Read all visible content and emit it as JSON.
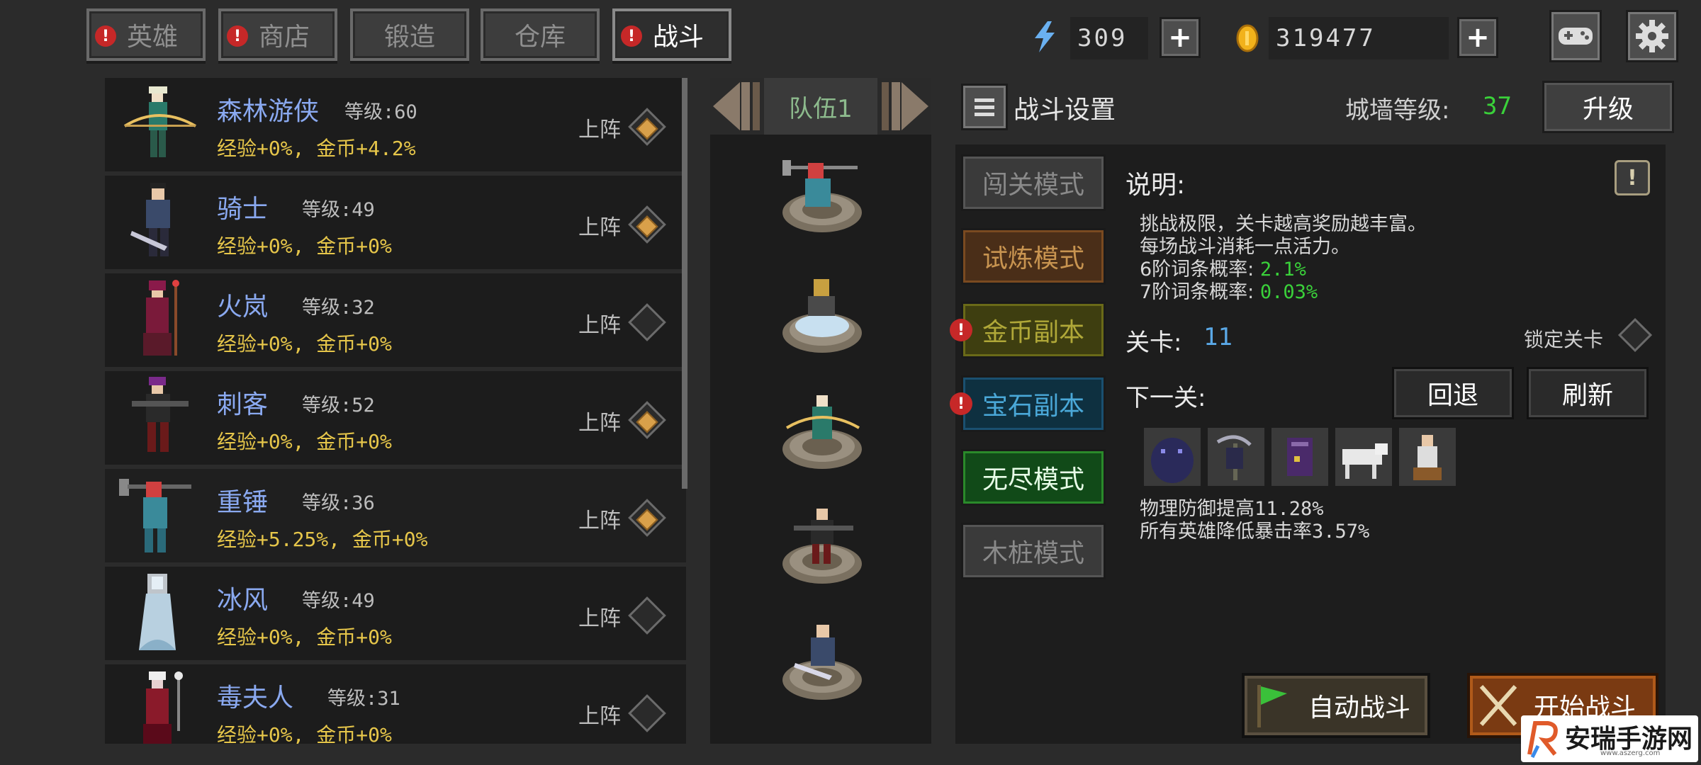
{
  "tabs": [
    {
      "label": "英雄",
      "alert": true,
      "active": false
    },
    {
      "label": "商店",
      "alert": true,
      "active": false
    },
    {
      "label": "锻造",
      "alert": false,
      "active": false
    },
    {
      "label": "仓库",
      "alert": false,
      "active": false
    },
    {
      "label": "战斗",
      "alert": true,
      "active": true
    }
  ],
  "alert_glyph": "!",
  "resources": {
    "energy": "309",
    "gold": "319477",
    "plus": "+"
  },
  "heroes": [
    {
      "name": "森林游侠",
      "level": "等级:60",
      "bonus": "经验+0%, 金币+4.2%",
      "deploy_label": "上阵",
      "deployed": true
    },
    {
      "name": "骑士",
      "level": "等级:49",
      "bonus": "经验+0%, 金币+0%",
      "deploy_label": "上阵",
      "deployed": true
    },
    {
      "name": "火岚",
      "level": "等级:32",
      "bonus": "经验+0%, 金币+0%",
      "deploy_label": "上阵",
      "deployed": false
    },
    {
      "name": "刺客",
      "level": "等级:52",
      "bonus": "经验+0%, 金币+0%",
      "deploy_label": "上阵",
      "deployed": true
    },
    {
      "name": "重锤",
      "level": "等级:36",
      "bonus": "经验+5.25%, 金币+0%",
      "deploy_label": "上阵",
      "deployed": true
    },
    {
      "name": "冰风",
      "level": "等级:49",
      "bonus": "经验+0%, 金币+0%",
      "deploy_label": "上阵",
      "deployed": false
    },
    {
      "name": "毒夫人",
      "level": "等级:31",
      "bonus": "经验+0%, 金币+0%",
      "deploy_label": "上阵",
      "deployed": false
    }
  ],
  "team": {
    "label": "队伍1"
  },
  "battle": {
    "settings_title": "战斗设置",
    "wall_label": "城墙等级:",
    "wall_level": "37",
    "upgrade": "升级",
    "modes": [
      {
        "label": "闯关模式",
        "alert": false
      },
      {
        "label": "试炼模式",
        "alert": false
      },
      {
        "label": "金币副本",
        "alert": true
      },
      {
        "label": "宝石副本",
        "alert": true
      },
      {
        "label": "无尽模式",
        "alert": false
      },
      {
        "label": "木桩模式",
        "alert": false
      }
    ],
    "desc_title": "说明:",
    "desc_lines": [
      {
        "text": "挑战极限，关卡越高奖励越丰富。",
        "val": ""
      },
      {
        "text": "每场战斗消耗一点活力。",
        "val": ""
      },
      {
        "text": "6阶词条概率: ",
        "val": "2.1%"
      },
      {
        "text": "7阶词条概率: ",
        "val": "0.03%"
      }
    ],
    "info_glyph": "!",
    "stage_label": "关卡:",
    "stage_value": "11",
    "lock_label": "锁定关卡",
    "next_label": "下一关:",
    "back": "回退",
    "refresh": "刷新",
    "effects": [
      "物理防御提高11.28%",
      "所有英雄降低暴击率3.57%"
    ],
    "auto_battle": "自动战斗",
    "start_battle": "开始战斗"
  },
  "watermark": {
    "text": "安瑞手游网",
    "sub": "www.aszerg.com"
  },
  "colors": {
    "background": "#2b2b2b",
    "hero_name": "#8aa9f0",
    "bonus": "#e6c64a",
    "green_value": "#3ad13a",
    "stage_value": "#5aa8e6",
    "alert": "#c62828"
  }
}
